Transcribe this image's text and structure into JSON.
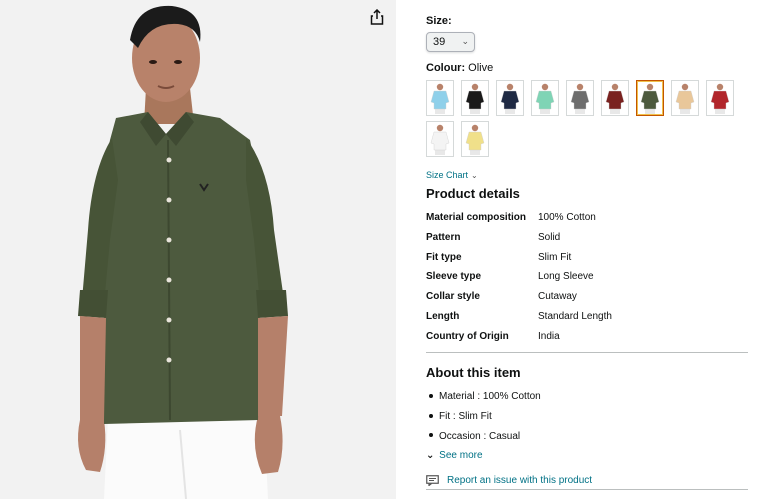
{
  "share": {
    "icon": "share-icon"
  },
  "size": {
    "label": "Size:",
    "selected": "39"
  },
  "colour": {
    "label": "Colour:",
    "selected": "Olive",
    "swatches": [
      {
        "color": "#8fd0ea",
        "selected": false
      },
      {
        "color": "#1a1a1a",
        "selected": false
      },
      {
        "color": "#1f2a44",
        "selected": false
      },
      {
        "color": "#7fd4b5",
        "selected": false
      },
      {
        "color": "#6d6d6d",
        "selected": false
      },
      {
        "color": "#7a2220",
        "selected": false
      },
      {
        "color": "#4d5a3e",
        "selected": true
      },
      {
        "color": "#e9c79a",
        "selected": false
      },
      {
        "color": "#b1262b",
        "selected": false
      },
      {
        "color": "#f4f4f4",
        "selected": false
      },
      {
        "color": "#f0e08a",
        "selected": false
      }
    ]
  },
  "size_chart": {
    "label": "Size Chart"
  },
  "product_details": {
    "title": "Product details",
    "rows": [
      {
        "key": "Material composition",
        "value": "100% Cotton"
      },
      {
        "key": "Pattern",
        "value": "Solid"
      },
      {
        "key": "Fit type",
        "value": "Slim Fit"
      },
      {
        "key": "Sleeve type",
        "value": "Long Sleeve"
      },
      {
        "key": "Collar style",
        "value": "Cutaway"
      },
      {
        "key": "Length",
        "value": "Standard Length"
      },
      {
        "key": "Country of Origin",
        "value": "India"
      }
    ]
  },
  "about": {
    "title": "About this item",
    "bullets": [
      "Material : 100% Cotton",
      "Fit : Slim Fit",
      "Occasion : Casual"
    ],
    "see_more": "See more"
  },
  "report": {
    "label": "Report an issue with this product"
  },
  "colors": {
    "link": "#007185",
    "selected_border": "#c45500",
    "shirt": "#4d5a3e"
  }
}
